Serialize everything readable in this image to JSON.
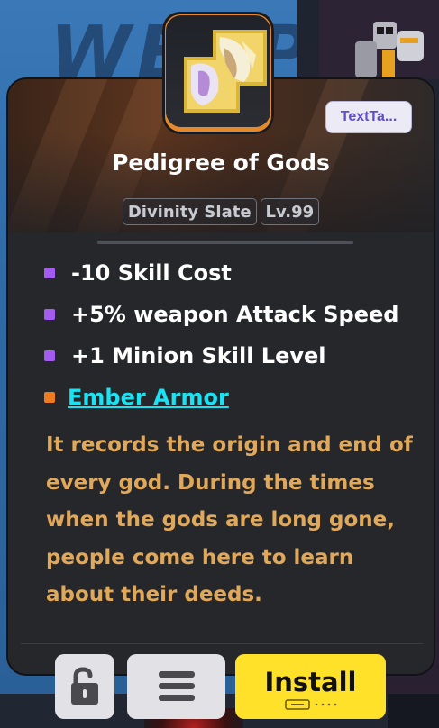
{
  "background": {
    "watermark_text": "WEAPON"
  },
  "tooltip": {
    "tag": "TextTa...",
    "item_name": "Pedigree of Gods",
    "chips": [
      "Divinity Slate",
      "Lv.99"
    ],
    "stats": [
      {
        "text": "-10 Skill Cost",
        "bullet_color": "#a45cf0"
      },
      {
        "text": "+5% weapon Attack Speed",
        "bullet_color": "#a45cf0"
      },
      {
        "text": "+1 Minion Skill Level",
        "bullet_color": "#a45cf0"
      }
    ],
    "set_link": {
      "text": "Ember Armor",
      "bullet_color": "#f07a1e"
    },
    "description": "It records the origin and end of every god. During the times when the gods are long gone, people come here to learn about their deeds."
  },
  "buttons": {
    "lock_icon": "unlock-icon",
    "menu_icon": "menu-icon",
    "install_label": "Install",
    "install_hint_icon": "keyboard-icon"
  },
  "colors": {
    "accent_yellow": "#ffe12a",
    "description_gold": "#e0a85a",
    "link_cyan": "#19e2f2",
    "tag_purple": "#5f4fc9"
  }
}
